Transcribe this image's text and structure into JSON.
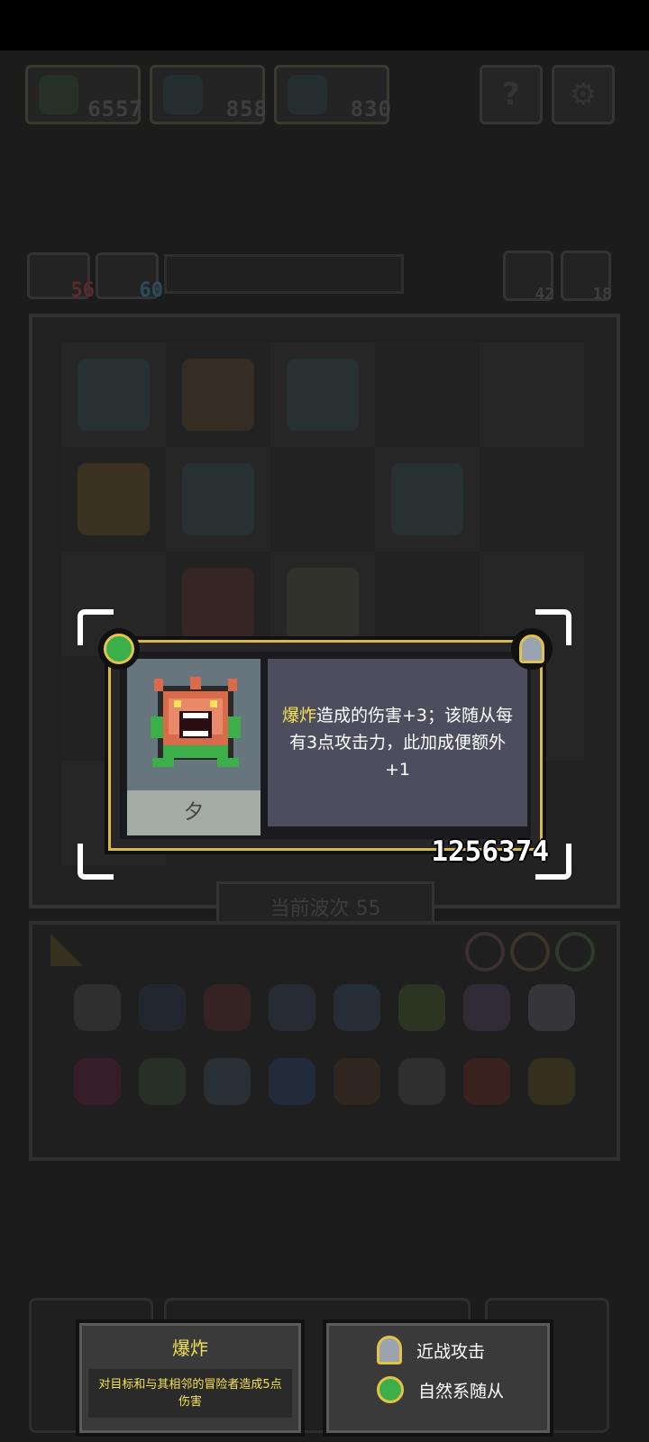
{
  "resources": [
    {
      "icon": "gem-icon",
      "value": "6557"
    },
    {
      "icon": "crystal-icon",
      "value": "858"
    },
    {
      "icon": "totem-icon",
      "value": "830"
    }
  ],
  "top_buttons": [
    {
      "icon": "help-icon",
      "label": "?"
    },
    {
      "icon": "settings-icon",
      "label": ""
    }
  ],
  "player_stats": {
    "eye_value": "56",
    "shield_value": "60",
    "reroll_value": "42",
    "key_value": "18"
  },
  "board": {
    "wave_label": "当前波次 55"
  },
  "tooltip": {
    "name": "夕",
    "keyword": "爆炸",
    "description_rest": "造成的伤害+3；该随从每有3点攻击力，此加成便额外+1",
    "score": "1256374",
    "badge_left": "clover-icon",
    "badge_right": "sword-icon"
  },
  "keyword_panel": {
    "title": "爆炸",
    "body": "对目标和与其相邻的冒险者造成5点伤害"
  },
  "tags_panel": {
    "tags": [
      {
        "icon": "sword-icon",
        "label": "近战攻击"
      },
      {
        "icon": "clover-icon",
        "label": "自然系随从"
      }
    ]
  },
  "colors": {
    "accent_yellow": "#f4e254",
    "card_border": "#d9b94a",
    "clover_green": "#3cae4a"
  }
}
